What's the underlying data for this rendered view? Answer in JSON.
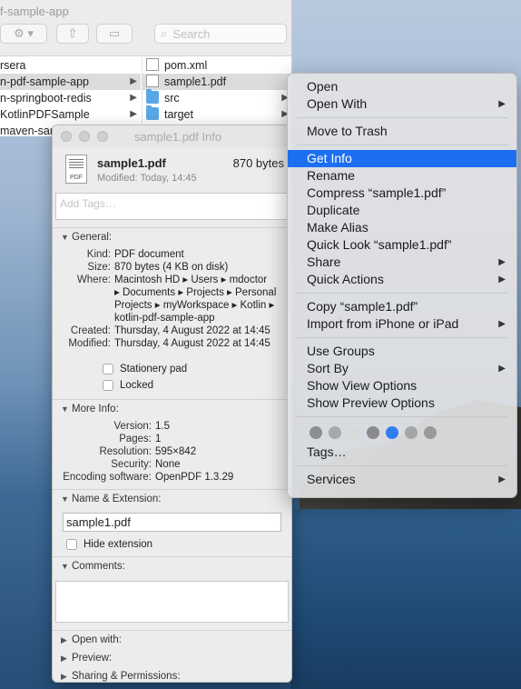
{
  "finder": {
    "title": "f-sample-app",
    "search_placeholder": "Search",
    "left_column": [
      "rsera",
      "n-pdf-sample-app",
      "n-springboot-redis",
      "KotlinPDFSample",
      "maven-sample-app"
    ],
    "right_column": [
      "pom.xml",
      "sample1.pdf",
      "src",
      "target"
    ]
  },
  "info_panel": {
    "title": "sample1.pdf Info",
    "file_name": "sample1.pdf",
    "file_size": "870 bytes",
    "modified_short": "Modified: Today, 14:45",
    "icon_label": "PDF",
    "tags_placeholder": "Add Tags…",
    "general": {
      "heading": "General:",
      "kind_label": "Kind:",
      "kind": "PDF document",
      "size_label": "Size:",
      "size": "870 bytes (4 KB on disk)",
      "where_label": "Where:",
      "where_lines": [
        "Macintosh HD ▸ Users ▸ mdoctor",
        "▸ Documents ▸ Projects ▸ Personal",
        "Projects ▸ myWorkspace ▸ Kotlin ▸",
        "kotlin-pdf-sample-app"
      ],
      "created_label": "Created:",
      "created": "Thursday, 4 August 2022 at 14:45",
      "modified_label": "Modified:",
      "modified": "Thursday, 4 August 2022 at 14:45",
      "stationery": "Stationery pad",
      "locked": "Locked"
    },
    "more_info": {
      "heading": "More Info:",
      "rows": [
        {
          "k": "Version:",
          "v": "1.5"
        },
        {
          "k": "Pages:",
          "v": "1"
        },
        {
          "k": "Resolution:",
          "v": "595×842"
        },
        {
          "k": "Security:",
          "v": "None"
        },
        {
          "k": "Encoding software:",
          "v": "OpenPDF 1.3.29"
        }
      ]
    },
    "name_ext": {
      "heading": "Name & Extension:",
      "value": "sample1.pdf",
      "hide_extension": "Hide extension"
    },
    "comments_heading": "Comments:",
    "open_with": "Open with:",
    "preview": "Preview:",
    "sharing": "Sharing & Permissions:"
  },
  "context_menu": {
    "group1": [
      "Open",
      "Open With"
    ],
    "group2": [
      "Move to Trash"
    ],
    "group3": [
      "Get Info",
      "Rename",
      "Compress “sample1.pdf”",
      "Duplicate",
      "Make Alias",
      "Quick Look “sample1.pdf”",
      "Share",
      "Quick Actions"
    ],
    "group4": [
      "Copy “sample1.pdf”",
      "Import from iPhone or iPad"
    ],
    "group5": [
      "Use Groups",
      "Sort By",
      "Show View Options",
      "Show Preview Options"
    ],
    "tag_colors": [
      "#8e8e8e",
      "#a9a9a9",
      "#d9d9d9",
      "#8a8a8a",
      "#2f7ef0",
      "#a5a5a5",
      "#9a9a9a"
    ],
    "tags_item": "Tags…",
    "services": "Services",
    "highlight_color": "#1d6ff2"
  }
}
